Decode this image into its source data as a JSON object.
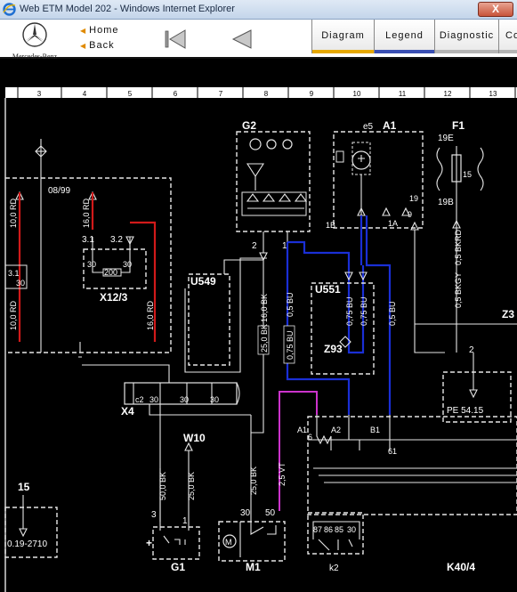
{
  "window": {
    "title": "Web ETM Model 202 - Windows Internet Explorer",
    "close_label": "X"
  },
  "header": {
    "brand": "Mercedes-Benz",
    "home_label": "Home",
    "back_label": "Back",
    "tabs": [
      {
        "label": "Diagram"
      },
      {
        "label": "Legend"
      },
      {
        "label": "Diagnostic"
      },
      {
        "label": "Co"
      }
    ]
  },
  "diagram": {
    "grid_numbers": [
      "3",
      "4",
      "5",
      "6",
      "7",
      "8",
      "9",
      "10",
      "11",
      "12",
      "13"
    ],
    "components": {
      "g2": "G2",
      "a1": "A1",
      "e5": "e5",
      "f1": "F1",
      "z3": "Z3",
      "u549": "U549",
      "u551": "U551",
      "z93": "Z93",
      "x12_3": "X12/3",
      "x4": "X4",
      "w10": "W10",
      "g1": "G1",
      "m1": "M1",
      "k2": "k2",
      "k40_4": "K40/4"
    },
    "labels": {
      "date_code": "08/99",
      "f1_top": "19E",
      "f1_mid": "15",
      "f1_bottom": "19B",
      "pin_1b": "1B",
      "pin_1a": "1A",
      "pin_19": "19",
      "pin_9": "9",
      "pin_31": "3.1",
      "pin_32": "3.2",
      "pin_30a": "30",
      "pin_30b": "30",
      "res_200": "200",
      "g2_pin2": "2",
      "g2_pin1": "1",
      "z3_pin": "2",
      "pe_ref": "PE 54.15",
      "left_ref": "0.19-2710",
      "wire_15": "15",
      "x4_c2": "c2",
      "x4_30": "30",
      "x4_30b": "30",
      "x4_30c": "30",
      "a1_label": "A1",
      "a2_label": "A2",
      "b1_label": "B1",
      "pin_6": "6",
      "pin_61": "61",
      "g1_3": "3",
      "g1_1": "1",
      "g1_plus": "+",
      "m1_30": "30",
      "m1_50": "50",
      "k2_87": "87",
      "k2_86": "86",
      "k2_85": "85",
      "k2_30": "30"
    },
    "wires": {
      "w_10rd_a": "10,0 RD",
      "w_16rd_a": "16,0 RD",
      "w_10rd_b": "10,0 RD",
      "w_16rd_b": "16,0 RD",
      "w_16bk": "16,0 BK",
      "w_25bk": "25,0 BK",
      "w_05bu_a": "0,5 BU",
      "w_075bu": "0,75 BU",
      "w_075bu_u1": "0,75 BU",
      "w_075bu_u2": "0,75 BU",
      "w_05bu_b": "0,5 BU",
      "w_05bkrd": "0,5 BKRD",
      "w_05bkgy": "0,5 BKGY",
      "w_50bk": "50,0 BK",
      "w_25bk_w10": "25,0 BK",
      "w_25bk_m1": "25,0 BK",
      "w_25vt": "2,5 VT"
    },
    "colors": {
      "wire_white": "#e6e6e6",
      "wire_red": "#d11a1a",
      "wire_blue": "#1a2fd6",
      "wire_violet": "#cc33cc",
      "tab_active": "#e6a800"
    }
  }
}
